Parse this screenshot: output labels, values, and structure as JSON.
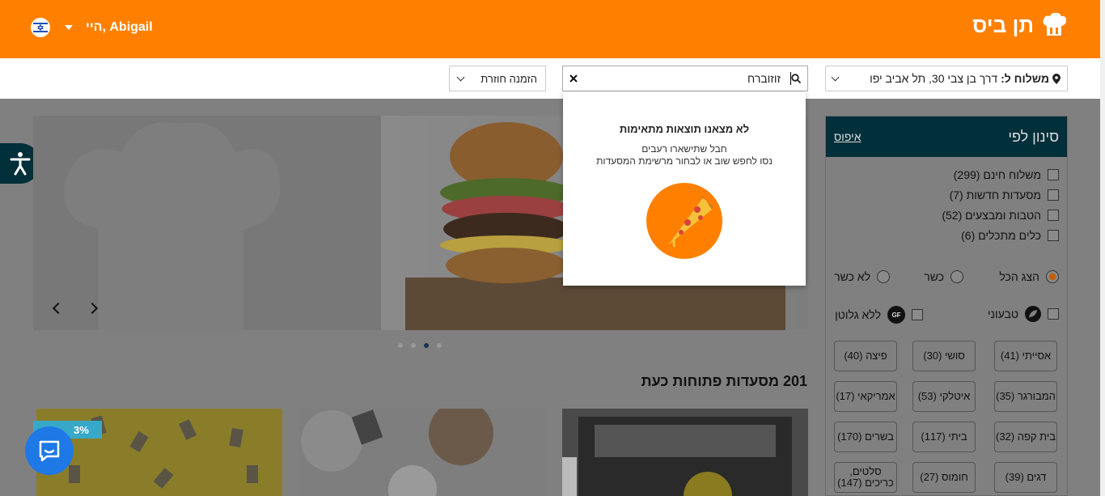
{
  "header": {
    "brand": "תן ביס",
    "greeting": "היי, Abigail"
  },
  "search_bar": {
    "address_label": "משלוח ל:",
    "address_value": "דרך בן צבי 30, תל אביב יפו",
    "search_value": "זוזוברח",
    "reorder_label": "הזמנה חוזרת"
  },
  "search_dropdown": {
    "title": "לא מצאנו תוצאות מתאימות",
    "line1": "חבל שתישארו רעבים",
    "line2": "נסו לחפש שוב או לבחור מרשימת המסעדות"
  },
  "carousel": {
    "dot_count": 4,
    "active_index": 2
  },
  "main": {
    "open_count_title": "201 מסעדות פתוחות כעת",
    "discount_badge": "3%"
  },
  "sidebar": {
    "title": "סינון לפי",
    "reset": "איפוס",
    "checkboxes": [
      "משלוח חינם (299)",
      "מסעדות חדשות (7)",
      "הטבות ומבצעים (52)",
      "כלים מתכלים (6)"
    ],
    "kosher": [
      "הצג הכל",
      "כשר",
      "לא כשר"
    ],
    "diet": [
      "טבעוני",
      "ללא גלוטן"
    ],
    "gf_badge": "GF",
    "tags": [
      "אסייתי (41)",
      "סושי (30)",
      "פיצה (40)",
      "המבורגר (35)",
      "איטלקי (53)",
      "אמריקאי (17)",
      "בית קפה (32)",
      "ביתי (117)",
      "בשרים (170)",
      "דגים (39)",
      "חומוס (27)",
      "סלטים, כריכים (147)"
    ]
  },
  "colors": {
    "brand_orange": "#ff8000",
    "sidebar_header": "#012f3a",
    "chat_blue": "#1e78e6"
  }
}
